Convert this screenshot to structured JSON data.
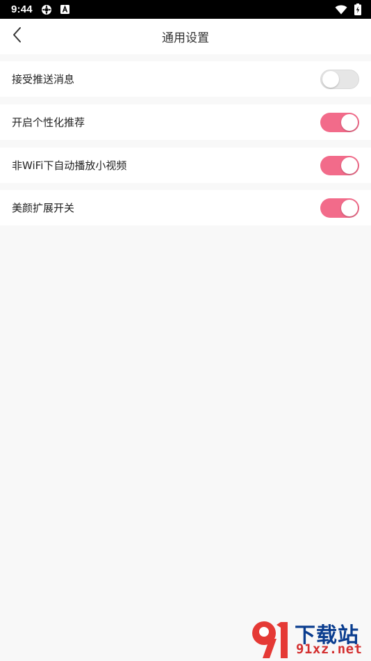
{
  "status_bar": {
    "time": "9:44",
    "icons": [
      "settings-gear-icon",
      "notification-a-icon",
      "wifi-icon",
      "battery-charging-icon"
    ]
  },
  "header": {
    "back_icon": "chevron-left-icon",
    "title": "通用设置"
  },
  "settings": [
    {
      "label": "接受推送消息",
      "enabled": false
    },
    {
      "label": "开启个性化推荐",
      "enabled": true
    },
    {
      "label": "非WiFi下自动播放小视频",
      "enabled": true
    },
    {
      "label": "美颜扩展开关",
      "enabled": true
    }
  ],
  "colors": {
    "toggle_on": "#f26b8a",
    "toggle_off": "#e6e6e6",
    "background": "#f8f8f8"
  },
  "watermark": {
    "line1": "下载站",
    "line2": "91xz.net"
  }
}
